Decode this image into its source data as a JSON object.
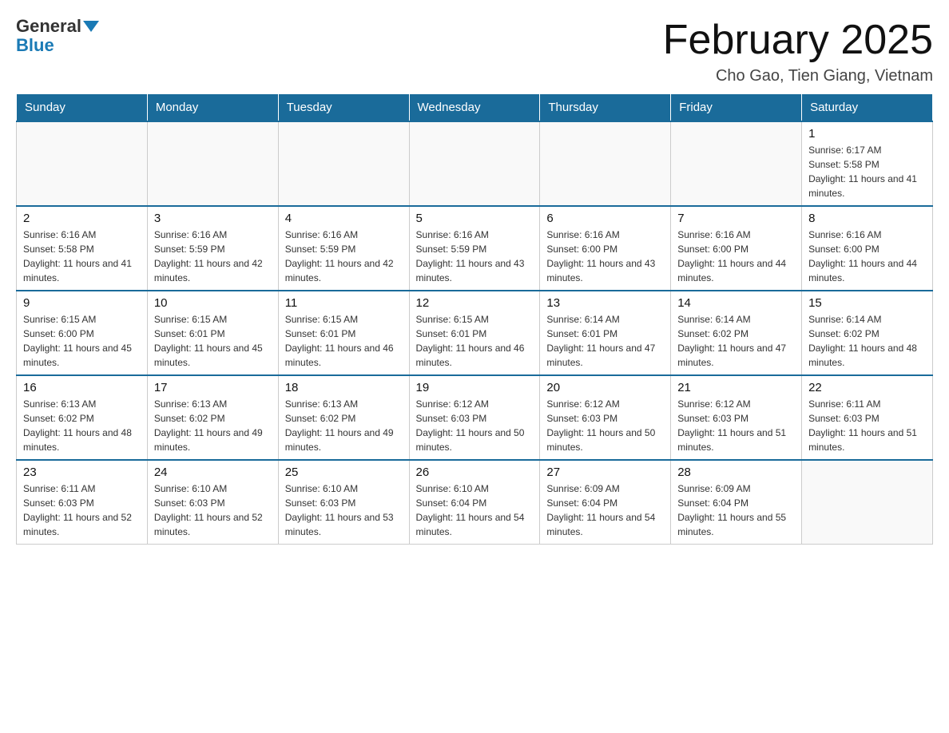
{
  "logo": {
    "general": "General",
    "blue": "Blue"
  },
  "header": {
    "title": "February 2025",
    "subtitle": "Cho Gao, Tien Giang, Vietnam"
  },
  "weekdays": [
    "Sunday",
    "Monday",
    "Tuesday",
    "Wednesday",
    "Thursday",
    "Friday",
    "Saturday"
  ],
  "weeks": [
    [
      {
        "day": "",
        "info": ""
      },
      {
        "day": "",
        "info": ""
      },
      {
        "day": "",
        "info": ""
      },
      {
        "day": "",
        "info": ""
      },
      {
        "day": "",
        "info": ""
      },
      {
        "day": "",
        "info": ""
      },
      {
        "day": "1",
        "info": "Sunrise: 6:17 AM\nSunset: 5:58 PM\nDaylight: 11 hours and 41 minutes."
      }
    ],
    [
      {
        "day": "2",
        "info": "Sunrise: 6:16 AM\nSunset: 5:58 PM\nDaylight: 11 hours and 41 minutes."
      },
      {
        "day": "3",
        "info": "Sunrise: 6:16 AM\nSunset: 5:59 PM\nDaylight: 11 hours and 42 minutes."
      },
      {
        "day": "4",
        "info": "Sunrise: 6:16 AM\nSunset: 5:59 PM\nDaylight: 11 hours and 42 minutes."
      },
      {
        "day": "5",
        "info": "Sunrise: 6:16 AM\nSunset: 5:59 PM\nDaylight: 11 hours and 43 minutes."
      },
      {
        "day": "6",
        "info": "Sunrise: 6:16 AM\nSunset: 6:00 PM\nDaylight: 11 hours and 43 minutes."
      },
      {
        "day": "7",
        "info": "Sunrise: 6:16 AM\nSunset: 6:00 PM\nDaylight: 11 hours and 44 minutes."
      },
      {
        "day": "8",
        "info": "Sunrise: 6:16 AM\nSunset: 6:00 PM\nDaylight: 11 hours and 44 minutes."
      }
    ],
    [
      {
        "day": "9",
        "info": "Sunrise: 6:15 AM\nSunset: 6:00 PM\nDaylight: 11 hours and 45 minutes."
      },
      {
        "day": "10",
        "info": "Sunrise: 6:15 AM\nSunset: 6:01 PM\nDaylight: 11 hours and 45 minutes."
      },
      {
        "day": "11",
        "info": "Sunrise: 6:15 AM\nSunset: 6:01 PM\nDaylight: 11 hours and 46 minutes."
      },
      {
        "day": "12",
        "info": "Sunrise: 6:15 AM\nSunset: 6:01 PM\nDaylight: 11 hours and 46 minutes."
      },
      {
        "day": "13",
        "info": "Sunrise: 6:14 AM\nSunset: 6:01 PM\nDaylight: 11 hours and 47 minutes."
      },
      {
        "day": "14",
        "info": "Sunrise: 6:14 AM\nSunset: 6:02 PM\nDaylight: 11 hours and 47 minutes."
      },
      {
        "day": "15",
        "info": "Sunrise: 6:14 AM\nSunset: 6:02 PM\nDaylight: 11 hours and 48 minutes."
      }
    ],
    [
      {
        "day": "16",
        "info": "Sunrise: 6:13 AM\nSunset: 6:02 PM\nDaylight: 11 hours and 48 minutes."
      },
      {
        "day": "17",
        "info": "Sunrise: 6:13 AM\nSunset: 6:02 PM\nDaylight: 11 hours and 49 minutes."
      },
      {
        "day": "18",
        "info": "Sunrise: 6:13 AM\nSunset: 6:02 PM\nDaylight: 11 hours and 49 minutes."
      },
      {
        "day": "19",
        "info": "Sunrise: 6:12 AM\nSunset: 6:03 PM\nDaylight: 11 hours and 50 minutes."
      },
      {
        "day": "20",
        "info": "Sunrise: 6:12 AM\nSunset: 6:03 PM\nDaylight: 11 hours and 50 minutes."
      },
      {
        "day": "21",
        "info": "Sunrise: 6:12 AM\nSunset: 6:03 PM\nDaylight: 11 hours and 51 minutes."
      },
      {
        "day": "22",
        "info": "Sunrise: 6:11 AM\nSunset: 6:03 PM\nDaylight: 11 hours and 51 minutes."
      }
    ],
    [
      {
        "day": "23",
        "info": "Sunrise: 6:11 AM\nSunset: 6:03 PM\nDaylight: 11 hours and 52 minutes."
      },
      {
        "day": "24",
        "info": "Sunrise: 6:10 AM\nSunset: 6:03 PM\nDaylight: 11 hours and 52 minutes."
      },
      {
        "day": "25",
        "info": "Sunrise: 6:10 AM\nSunset: 6:03 PM\nDaylight: 11 hours and 53 minutes."
      },
      {
        "day": "26",
        "info": "Sunrise: 6:10 AM\nSunset: 6:04 PM\nDaylight: 11 hours and 54 minutes."
      },
      {
        "day": "27",
        "info": "Sunrise: 6:09 AM\nSunset: 6:04 PM\nDaylight: 11 hours and 54 minutes."
      },
      {
        "day": "28",
        "info": "Sunrise: 6:09 AM\nSunset: 6:04 PM\nDaylight: 11 hours and 55 minutes."
      },
      {
        "day": "",
        "info": ""
      }
    ]
  ]
}
